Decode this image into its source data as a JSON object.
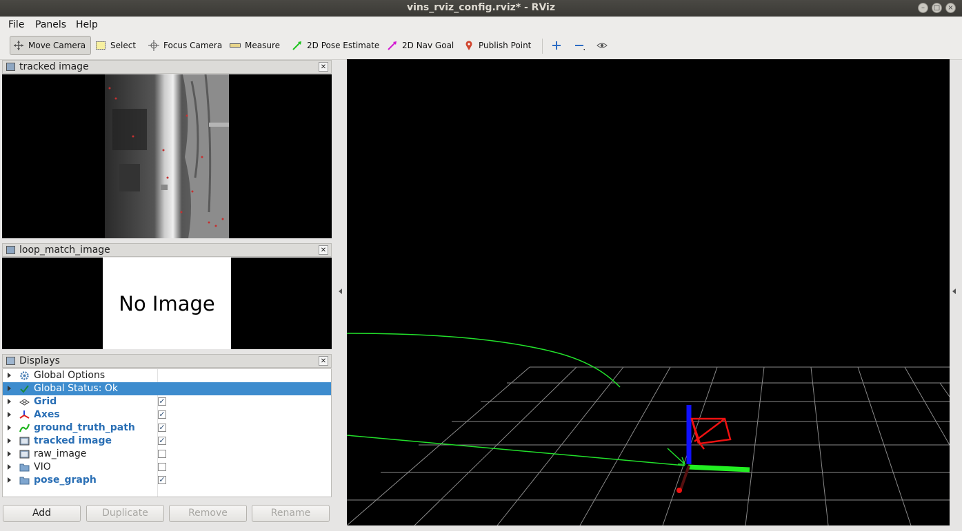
{
  "window": {
    "title": "vins_rviz_config.rviz* - RViz"
  },
  "menu": [
    "File",
    "Panels",
    "Help"
  ],
  "toolbar": {
    "move_camera": "Move Camera",
    "select": "Select",
    "focus_camera": "Focus Camera",
    "measure": "Measure",
    "pose_estimate": "2D Pose Estimate",
    "nav_goal": "2D Nav Goal",
    "publish_point": "Publish Point"
  },
  "panels": {
    "tracked": {
      "title": "tracked image"
    },
    "loop": {
      "title": "loop_match_image",
      "placeholder": "No Image"
    },
    "displays": {
      "title": "Displays",
      "items": [
        {
          "label": "Global Options",
          "checked": null,
          "bold": false
        },
        {
          "label": "Global Status: Ok",
          "checked": null,
          "bold": false,
          "selected": true
        },
        {
          "label": "Grid",
          "checked": true,
          "bold": true
        },
        {
          "label": "Axes",
          "checked": true,
          "bold": true
        },
        {
          "label": "ground_truth_path",
          "checked": true,
          "bold": true
        },
        {
          "label": "tracked image",
          "checked": true,
          "bold": true
        },
        {
          "label": "raw_image",
          "checked": false,
          "bold": false
        },
        {
          "label": "VIO",
          "checked": false,
          "bold": false
        },
        {
          "label": "pose_graph",
          "checked": true,
          "bold": true
        }
      ]
    }
  },
  "buttons": {
    "add": "Add",
    "duplicate": "Duplicate",
    "remove": "Remove",
    "rename": "Rename"
  },
  "check_glyph": "✓",
  "colors": {
    "selection": "#3d8cce",
    "path": "#22e02b",
    "axis_x": "#ff0000",
    "axis_y": "#00ff00",
    "axis_z": "#0000ff"
  }
}
